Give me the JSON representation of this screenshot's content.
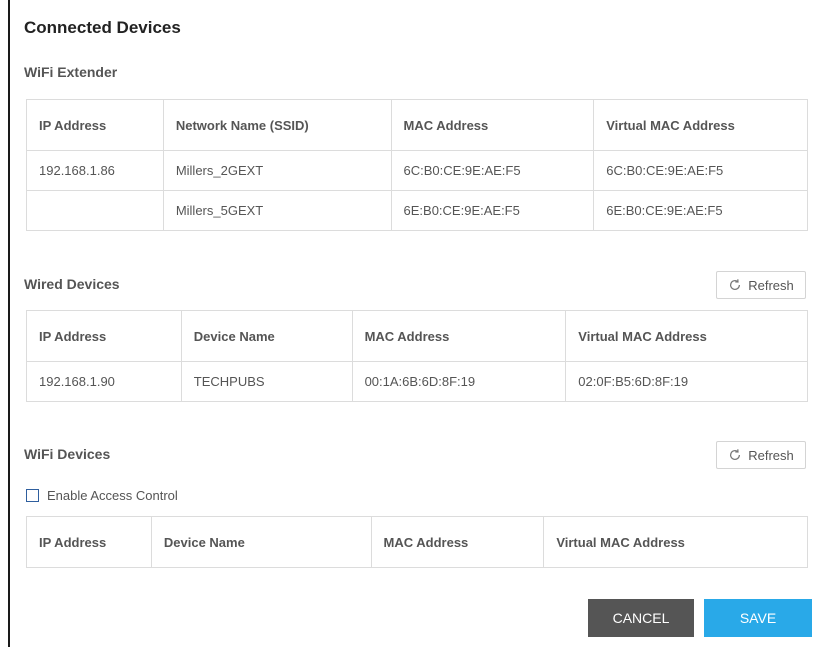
{
  "page_title": "Connected Devices",
  "wifi_extender": {
    "title": "WiFi Extender",
    "headers": [
      "IP Address",
      "Network Name (SSID)",
      "MAC Address",
      "Virtual MAC Address"
    ],
    "rows": [
      [
        "192.168.1.86",
        "Millers_2GEXT",
        "6C:B0:CE:9E:AE:F5",
        "6C:B0:CE:9E:AE:F5"
      ],
      [
        "",
        "Millers_5GEXT",
        "6E:B0:CE:9E:AE:F5",
        "6E:B0:CE:9E:AE:F5"
      ]
    ]
  },
  "wired_devices": {
    "title": "Wired Devices",
    "refresh_label": "Refresh",
    "headers": [
      "IP Address",
      "Device Name",
      "MAC Address",
      "Virtual MAC Address"
    ],
    "rows": [
      [
        "192.168.1.90",
        "TECHPUBS",
        "00:1A:6B:6D:8F:19",
        "02:0F:B5:6D:8F:19"
      ]
    ]
  },
  "wifi_devices": {
    "title": "WiFi Devices",
    "refresh_label": "Refresh",
    "access_control_label": "Enable Access Control",
    "access_control_checked": false,
    "headers": [
      "IP Address",
      "Device Name",
      "MAC Address",
      "Virtual MAC Address"
    ],
    "rows": []
  },
  "buttons": {
    "cancel": "CANCEL",
    "save": "SAVE"
  },
  "colors": {
    "save": "#29a9e8",
    "cancel": "#555555"
  },
  "icons": {
    "refresh": "refresh-icon"
  }
}
